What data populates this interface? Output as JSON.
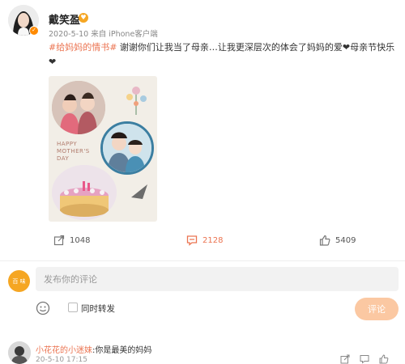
{
  "post": {
    "author": "戴笑盈",
    "date": "2020-5-10",
    "source": "来自 iPhone客户端",
    "hashtag": "#给妈妈的情书#",
    "text": " 谢谢你们让我当了母亲…让我更深层次的体会了妈妈的爱❤母亲节快乐❤",
    "image_caption": "HAPPY MOTHER'S DAY"
  },
  "actions": {
    "repost_count": "1048",
    "comment_count": "2128",
    "like_count": "5409"
  },
  "composer": {
    "avatar_text": "百 味",
    "placeholder": "发布你的评论",
    "repost_label": "同时转发",
    "submit_label": "评论"
  },
  "comments": [
    {
      "user": "小花花的小迷妹",
      "text": ":你是最美的妈妈",
      "time": "20-5-10 17:15"
    }
  ],
  "colors": {
    "accent": "#eb7350",
    "submit_bg": "#fbc8a2"
  }
}
